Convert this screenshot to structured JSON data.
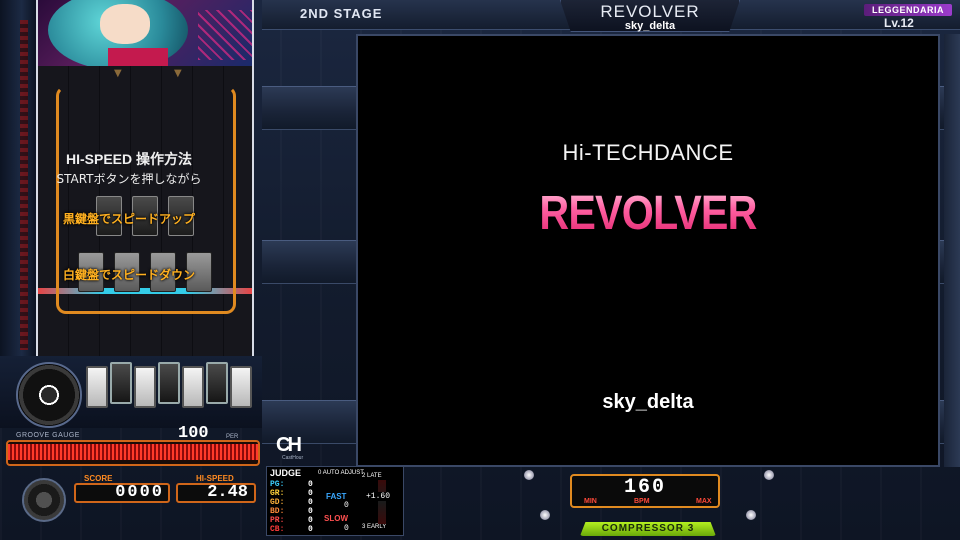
{
  "header": {
    "stage": "2ND STAGE",
    "song_title": "REVOLVER",
    "artist": "sky_delta",
    "difficulty": "LEGGENDARIA",
    "level": "Lv.12"
  },
  "movie": {
    "genre": "Hi-TECHDANCE",
    "title": "REVOLVER",
    "artist": "sky_delta"
  },
  "hispeed_guide": {
    "heading": "HI-SPEED 操作方法",
    "instruction": "STARTボタンを押しながら",
    "black_keys": "黒鍵盤でスピードアップ",
    "white_keys": "白鍵盤でスピードダウン"
  },
  "groove_gauge": {
    "label": "GROOVE GAUGE",
    "value": "100",
    "unit": "PER",
    "fill_fraction": 1.0
  },
  "score": {
    "label": "SCORE",
    "value": "0000"
  },
  "hispeed": {
    "label": "HI-SPEED",
    "value": "2.48"
  },
  "logo": {
    "text": "CH",
    "subtitle": "CastHour"
  },
  "judge": {
    "heading": "JUDGE",
    "auto_adjust": "AUTO ADJUST",
    "auto_key": "0",
    "late": "LATE",
    "early": "EARLY",
    "late_key": "2",
    "early_key": "3",
    "rows": [
      {
        "label": "PG:",
        "count": "0",
        "color": "#3ad0ff"
      },
      {
        "label": "GR:",
        "count": "0",
        "color": "#ffd23a"
      },
      {
        "label": "GD:",
        "count": "0",
        "color": "#ffb23a"
      },
      {
        "label": "BD:",
        "count": "0",
        "color": "#ff8a3a"
      },
      {
        "label": "PR:",
        "count": "0",
        "color": "#ff4a4a"
      },
      {
        "label": "CB:",
        "count": "0",
        "color": "#ff3a3a"
      }
    ],
    "fast_label": "FAST",
    "fast_value": "0",
    "slow_label": "SLOW",
    "slow_value": "0",
    "offset": "+1.60"
  },
  "bpm": {
    "value": "160",
    "unit": "BPM",
    "min_label": "MIN",
    "max_label": "MAX"
  },
  "compressor": "COMPRESSOR 3"
}
